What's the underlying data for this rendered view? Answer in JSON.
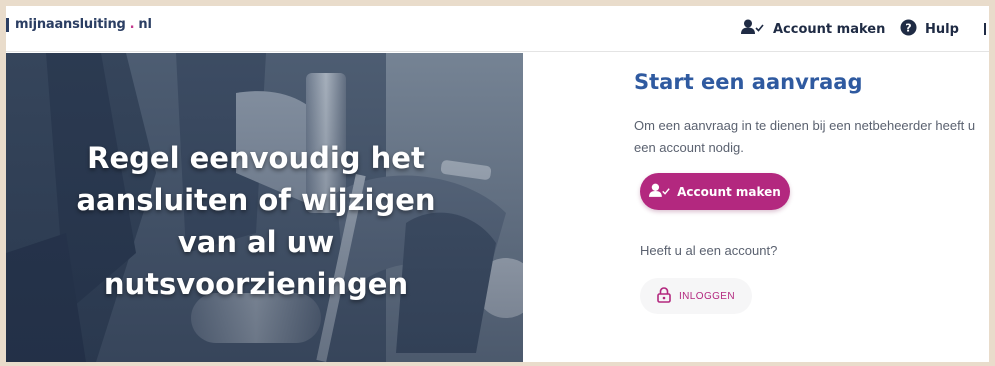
{
  "header": {
    "logo_main": "mijnaansluiting",
    "logo_dot": ".",
    "logo_tld": "nl",
    "nav": {
      "account_label": "Account maken",
      "help_label": "Hulp"
    }
  },
  "hero": {
    "text_line1": "Regel eenvoudig het",
    "text_line2": "aansluiten of wijzigen",
    "text_line3": "van al uw",
    "text_line4": "nutsvoorzieningen"
  },
  "panel": {
    "title": "Start een aanvraag",
    "description": "Om een aanvraag in te dienen bij een netbeheerder heeft u een account nodig.",
    "account_button": "Account maken",
    "have_account": "Heeft u al een account?",
    "login_button": "INLOGGEN"
  },
  "colors": {
    "brand_blue": "#2f5aa0",
    "brand_magenta": "#b3287f",
    "text_dark": "#1f2b44"
  },
  "icons": [
    "user-check-icon",
    "help-circle-icon",
    "lock-icon"
  ]
}
